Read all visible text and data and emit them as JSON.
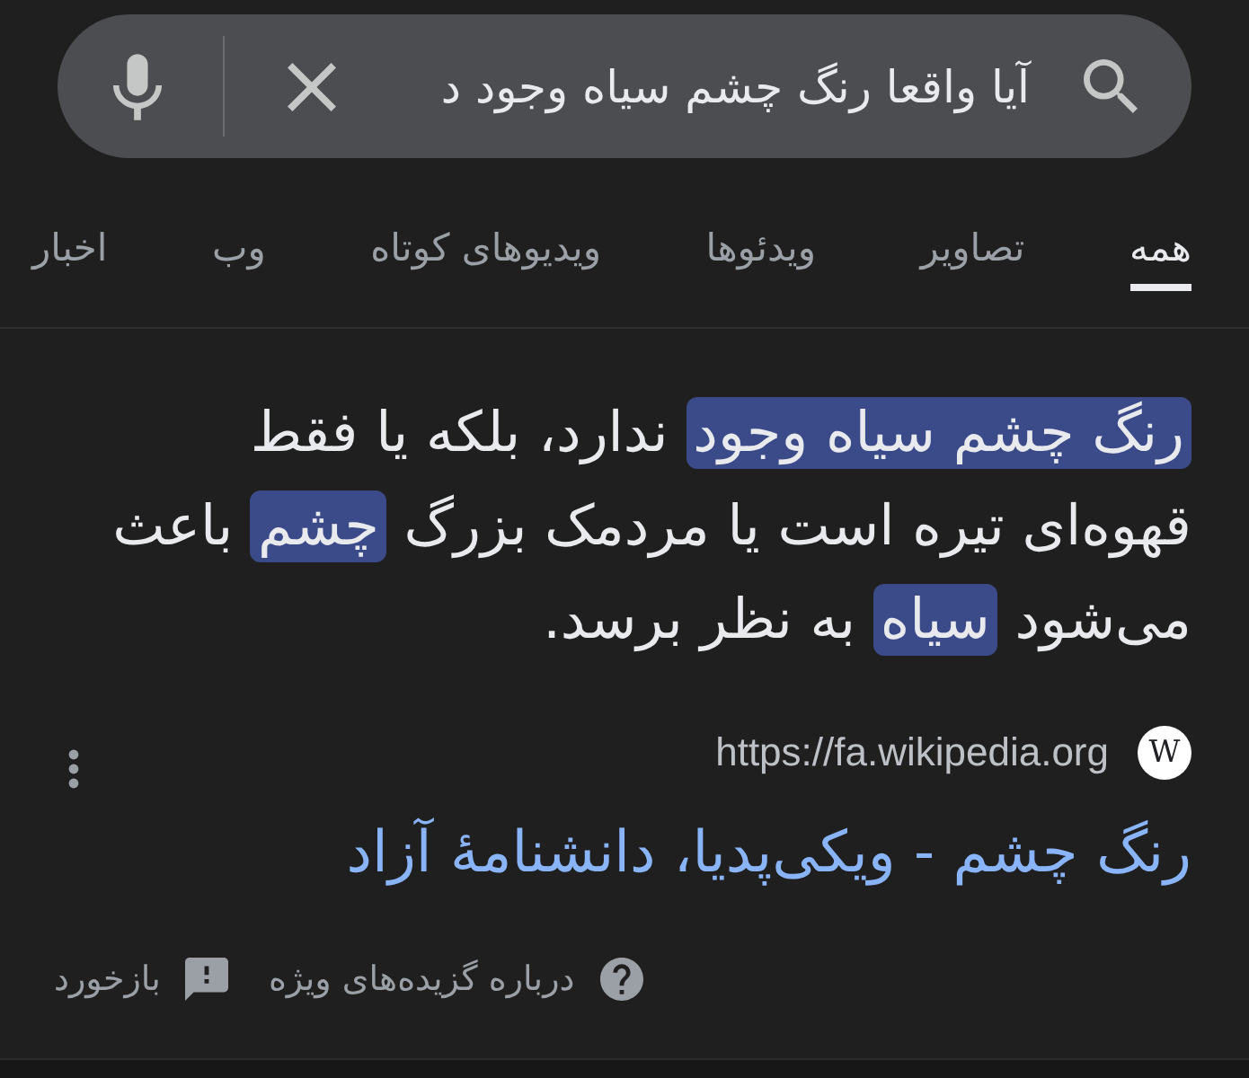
{
  "search": {
    "query": "آیا واقعا رنگ چشم سیاه وجود د"
  },
  "tabs": [
    {
      "label": "همه",
      "selected": true
    },
    {
      "label": "تصاویر",
      "selected": false
    },
    {
      "label": "ویدئوها",
      "selected": false
    },
    {
      "label": "ویدیوهای کوتاه",
      "selected": false
    },
    {
      "label": "وب",
      "selected": false
    },
    {
      "label": "اخبار",
      "selected": false
    }
  ],
  "snippet": {
    "segments": [
      {
        "text": "رنگ چشم سیاه وجود",
        "highlighted": true
      },
      {
        "text": " ندارد، بلکه یا فقط قهوه‌ای تیره است یا مردمک بزرگ ",
        "highlighted": false
      },
      {
        "text": "چشم",
        "highlighted": true
      },
      {
        "text": " باعث می‌شود ",
        "highlighted": false
      },
      {
        "text": "سیاه",
        "highlighted": true
      },
      {
        "text": " به نظر برسد.",
        "highlighted": false
      }
    ]
  },
  "result": {
    "site_logo": "W",
    "url": "https://fa.wikipedia.org",
    "title": "رنگ چشم - ویکی‌پدیا، دانشنامهٔ آزاد"
  },
  "footer": {
    "links": [
      {
        "kind": "help",
        "label": "درباره گزیده‌های ویژه"
      },
      {
        "kind": "feedback",
        "label": "بازخورد"
      }
    ]
  }
}
